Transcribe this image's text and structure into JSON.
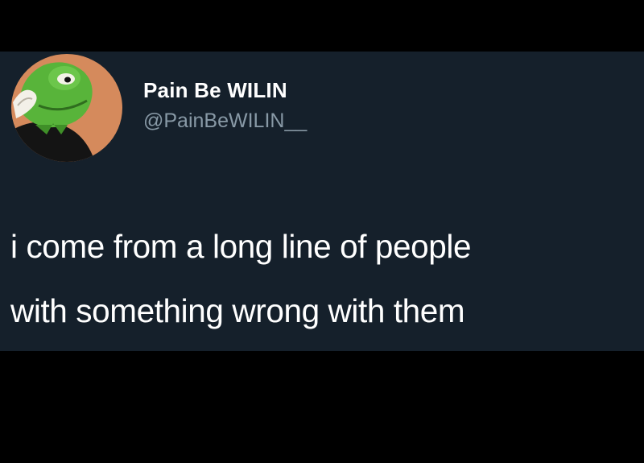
{
  "tweet": {
    "author": {
      "display_name": "Pain Be WILIN",
      "handle": "@PainBeWILIN__",
      "avatar_icon": "kermit-frog-avatar-icon"
    },
    "text_lines": [
      "i come from a long line of people",
      "with something wrong with them"
    ]
  },
  "colors": {
    "page_background": "#000000",
    "card_background": "#15202b",
    "name_text": "#ffffff",
    "handle_text": "#8899a6",
    "body_text": "#ffffff",
    "avatar_background": "#d58a5c"
  }
}
